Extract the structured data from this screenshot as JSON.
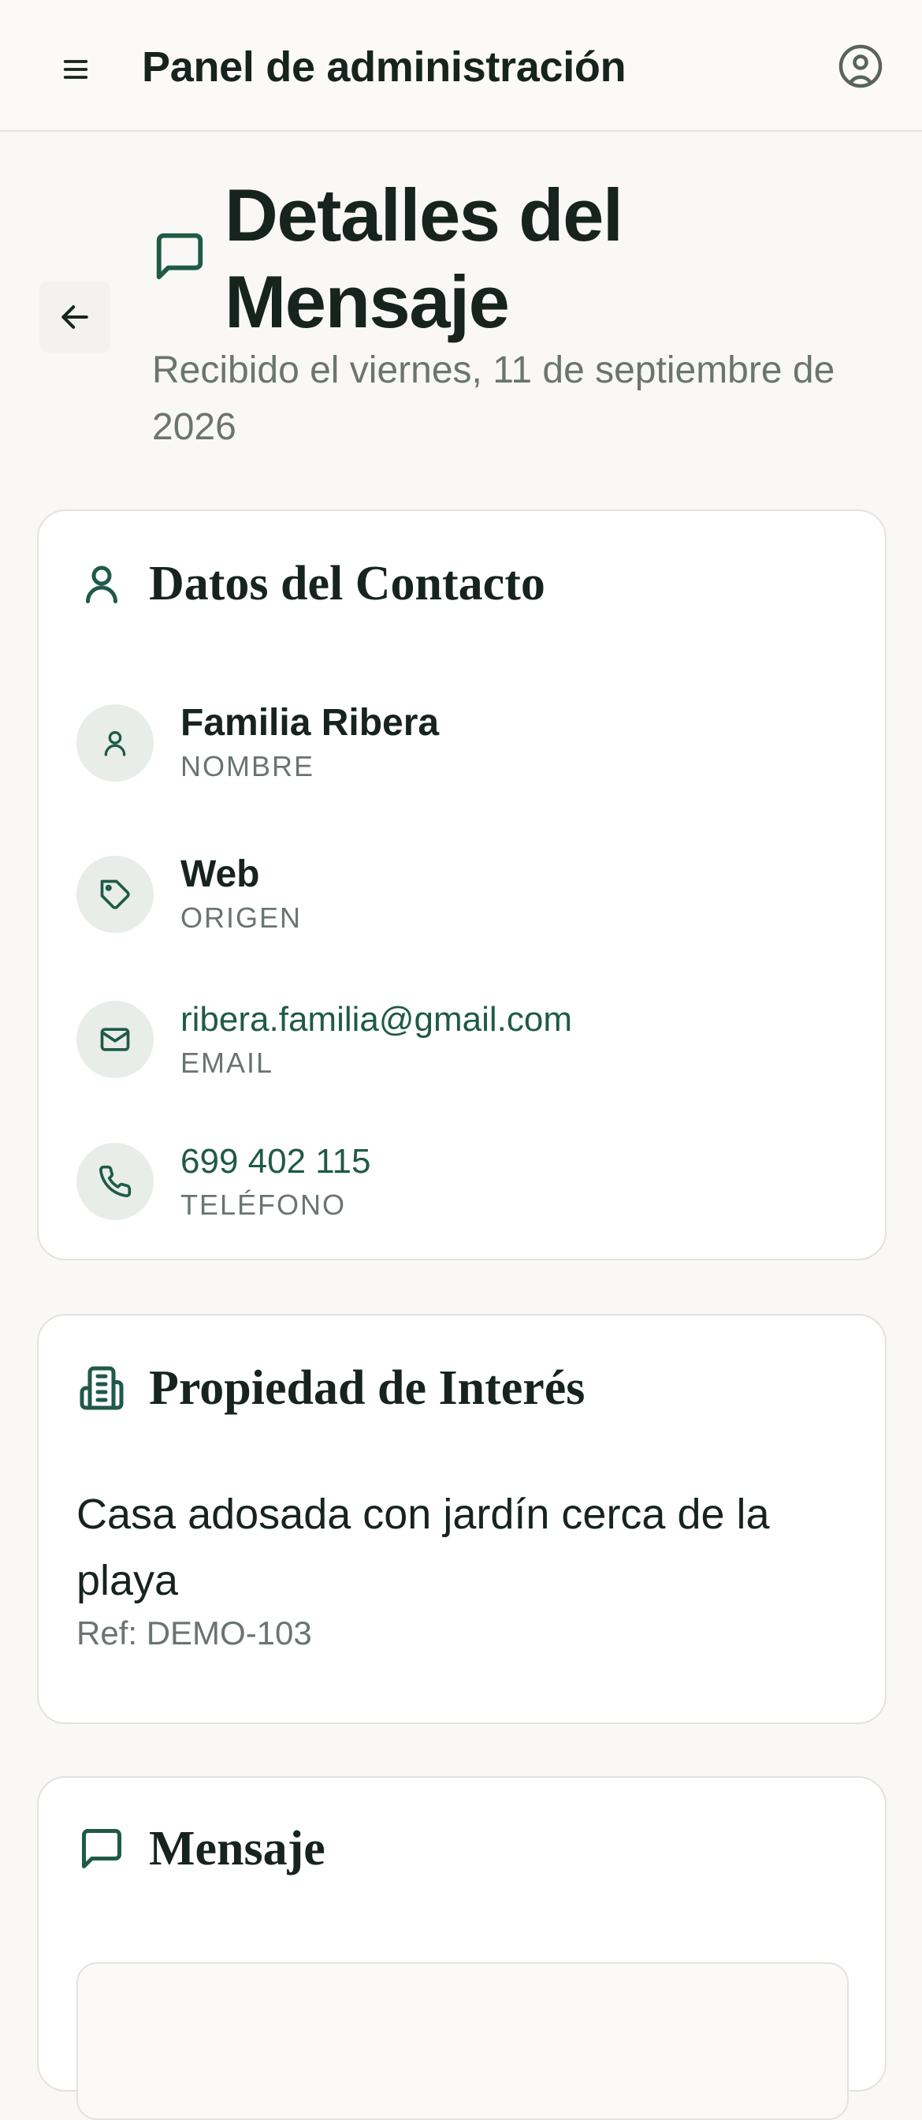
{
  "header": {
    "title": "Panel de administración",
    "menu_icon": "menu-icon",
    "user_icon": "user-circle-icon"
  },
  "page": {
    "title": "Detalles del Mensaje",
    "subtitle": "Recibido el viernes, 11 de septiembre de 2026",
    "back_icon": "arrow-left-icon",
    "title_icon": "message-square-icon"
  },
  "contact": {
    "title": "Datos del Contacto",
    "rows": [
      {
        "value": "Familia Ribera",
        "label": "NOMBRE",
        "icon": "user-icon"
      },
      {
        "value": "Web",
        "label": "ORIGEN",
        "icon": "tag-icon"
      },
      {
        "value": "ribera.familia@gmail.com",
        "label": "EMAIL",
        "icon": "mail-icon"
      },
      {
        "value": "699 402 115",
        "label": "TELÉFONO",
        "icon": "phone-icon"
      }
    ]
  },
  "property": {
    "title": "Propiedad de Interés",
    "name": "Casa adosada con jardín cerca de la playa",
    "ref": "Ref: DEMO-103",
    "icon": "building-icon"
  },
  "message": {
    "title": "Mensaje",
    "icon": "message-square-icon"
  },
  "colors": {
    "accent": "#1f5a48",
    "background": "#f9f8f6",
    "icon_circle": "#e8ede9",
    "muted_text": "#6b7470"
  }
}
